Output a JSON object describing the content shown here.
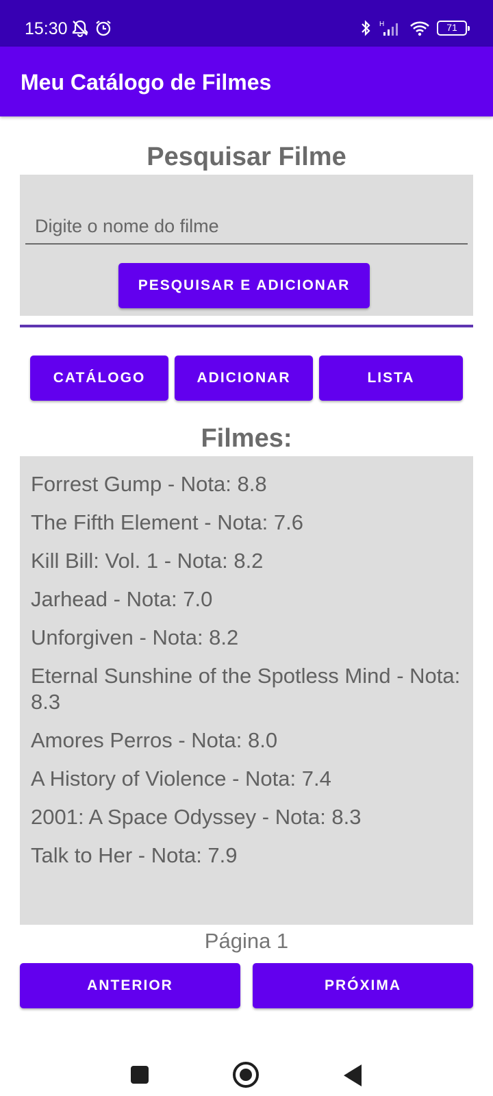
{
  "status_bar": {
    "time": "15:30",
    "battery": "71",
    "network_type": "H",
    "left_icons": [
      "mute-icon",
      "alarm-icon"
    ],
    "right_icons": [
      "bluetooth-icon",
      "signal-icon",
      "wifi-icon",
      "battery-icon"
    ]
  },
  "app_bar": {
    "title": "Meu Catálogo de Filmes"
  },
  "search": {
    "title": "Pesquisar Filme",
    "placeholder": "Digite o nome do filme",
    "button_label": "PESQUISAR E ADICIONAR"
  },
  "tabs": [
    {
      "label": "CATÁLOGO"
    },
    {
      "label": "ADICIONAR"
    },
    {
      "label": "LISTA"
    }
  ],
  "movies": {
    "title": "Filmes:",
    "items": [
      "Forrest Gump - Nota: 8.8",
      "The Fifth Element - Nota: 7.6",
      "Kill Bill: Vol. 1 - Nota: 8.2",
      "Jarhead - Nota: 7.0",
      "Unforgiven - Nota: 8.2",
      "Eternal Sunshine of the Spotless Mind - Nota: 8.3",
      "Amores Perros - Nota: 8.0",
      "A History of Violence - Nota: 7.4",
      "2001: A Space Odyssey - Nota: 8.3",
      "Talk to Her - Nota: 7.9"
    ]
  },
  "pagination": {
    "page_label": "Página 1",
    "prev_label": "ANTERIOR",
    "next_label": "PRÓXIMA"
  },
  "colors": {
    "status_bar": "#3700b3",
    "primary": "#6200ee",
    "panel": "#dddddd",
    "text": "#616161"
  }
}
